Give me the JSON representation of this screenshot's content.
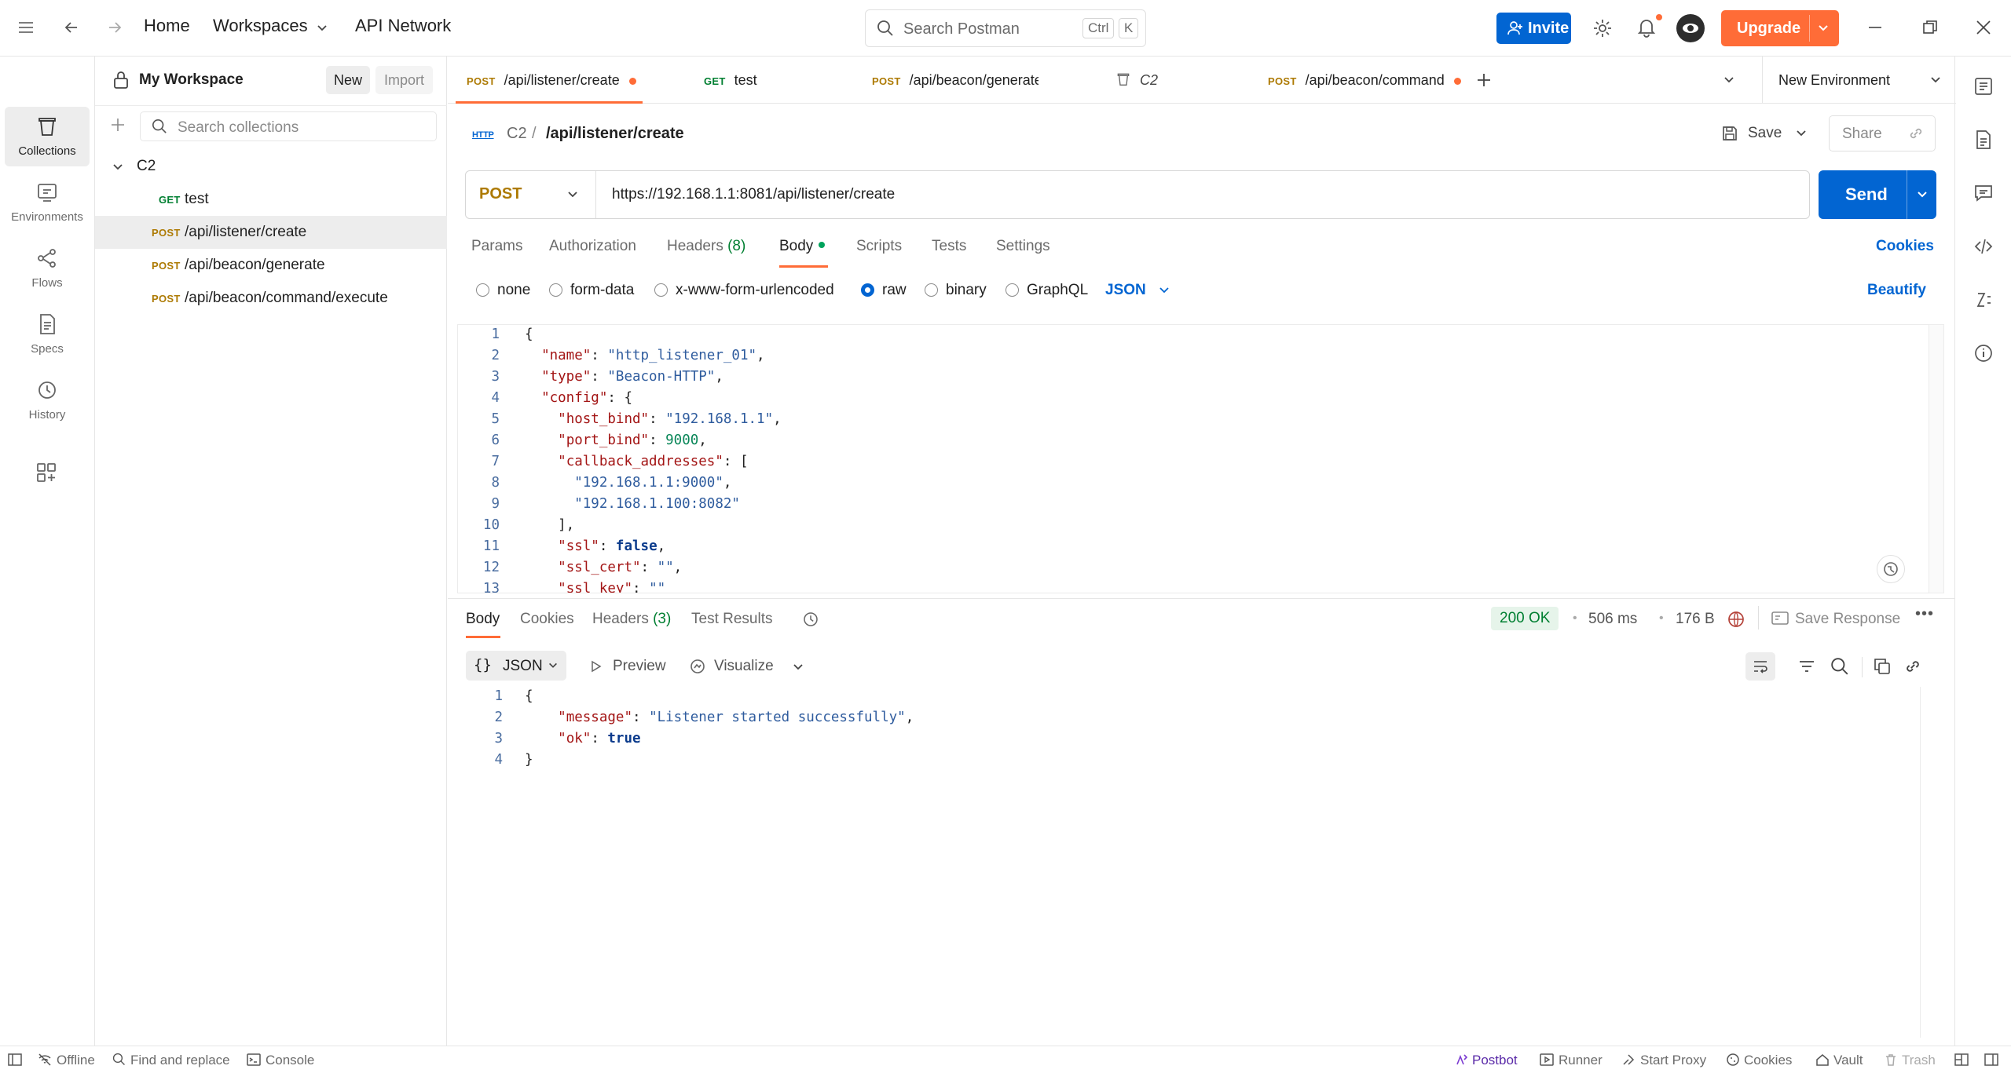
{
  "topbar": {
    "home": "Home",
    "workspaces": "Workspaces",
    "api_network": "API Network",
    "search_placeholder": "Search Postman",
    "kbd_ctrl": "Ctrl",
    "kbd_k": "K",
    "invite": "Invite",
    "upgrade": "Upgrade"
  },
  "rail": {
    "collections": "Collections",
    "environments": "Environments",
    "flows": "Flows",
    "specs": "Specs",
    "history": "History"
  },
  "sidebar": {
    "workspace": "My Workspace",
    "new": "New",
    "import": "Import",
    "search_placeholder": "Search collections",
    "collection": "C2",
    "items": [
      {
        "method": "GET",
        "name": "test"
      },
      {
        "method": "POST",
        "name": "/api/listener/create"
      },
      {
        "method": "POST",
        "name": "/api/beacon/generate"
      },
      {
        "method": "POST",
        "name": "/api/beacon/command/execute"
      }
    ]
  },
  "tabs": [
    {
      "method": "POST",
      "name": "/api/listener/create"
    },
    {
      "method": "GET",
      "name": "test"
    },
    {
      "method": "POST",
      "name": "/api/beacon/generate"
    },
    {
      "method": "",
      "name": "C2"
    },
    {
      "method": "POST",
      "name": "/api/beacon/command"
    }
  ],
  "environment": "New Environment",
  "request": {
    "crumb_icon": "HTTP",
    "crumb_collection": "C2",
    "crumb_sep": "/",
    "crumb_name": "/api/listener/create",
    "save": "Save",
    "share": "Share",
    "method": "POST",
    "url": "https://192.168.1.1:8081/api/listener/create",
    "send": "Send",
    "tabs": {
      "params": "Params",
      "authorization": "Authorization",
      "headers": "Headers",
      "headers_count": "(8)",
      "body": "Body",
      "scripts": "Scripts",
      "tests": "Tests",
      "settings": "Settings",
      "cookies": "Cookies"
    },
    "body_types": {
      "none": "none",
      "form_data": "form-data",
      "urlencoded": "x-www-form-urlencoded",
      "raw": "raw",
      "binary": "binary",
      "graphql": "GraphQL",
      "lang": "JSON",
      "beautify": "Beautify"
    },
    "body_lines": [
      [
        [
          "p",
          "{"
        ]
      ],
      [
        [
          "p",
          "  "
        ],
        [
          "k",
          "\"name\""
        ],
        [
          "p",
          ": "
        ],
        [
          "s",
          "\"http_listener_01\""
        ],
        [
          "p",
          ","
        ]
      ],
      [
        [
          "p",
          "  "
        ],
        [
          "k",
          "\"type\""
        ],
        [
          "p",
          ": "
        ],
        [
          "s",
          "\"Beacon-HTTP\""
        ],
        [
          "p",
          ","
        ]
      ],
      [
        [
          "p",
          "  "
        ],
        [
          "k",
          "\"config\""
        ],
        [
          "p",
          ": {"
        ]
      ],
      [
        [
          "p",
          "    "
        ],
        [
          "k",
          "\"host_bind\""
        ],
        [
          "p",
          ": "
        ],
        [
          "s",
          "\"192.168.1.1\""
        ],
        [
          "p",
          ","
        ]
      ],
      [
        [
          "p",
          "    "
        ],
        [
          "k",
          "\"port_bind\""
        ],
        [
          "p",
          ": "
        ],
        [
          "n",
          "9000"
        ],
        [
          "p",
          ","
        ]
      ],
      [
        [
          "p",
          "    "
        ],
        [
          "k",
          "\"callback_addresses\""
        ],
        [
          "p",
          ": ["
        ]
      ],
      [
        [
          "p",
          "      "
        ],
        [
          "s",
          "\"192.168.1.1:9000\""
        ],
        [
          "p",
          ","
        ]
      ],
      [
        [
          "p",
          "      "
        ],
        [
          "s",
          "\"192.168.1.100:8082\""
        ]
      ],
      [
        [
          "p",
          "    ],"
        ]
      ],
      [
        [
          "p",
          "    "
        ],
        [
          "k",
          "\"ssl\""
        ],
        [
          "p",
          ": "
        ],
        [
          "b",
          "false"
        ],
        [
          "p",
          ","
        ]
      ],
      [
        [
          "p",
          "    "
        ],
        [
          "k",
          "\"ssl_cert\""
        ],
        [
          "p",
          ": "
        ],
        [
          "s",
          "\"\""
        ],
        [
          "p",
          ","
        ]
      ],
      [
        [
          "p",
          "    "
        ],
        [
          "k",
          "\"ssl_key\""
        ],
        [
          "p",
          ": "
        ],
        [
          "s",
          "\"\""
        ]
      ]
    ]
  },
  "response": {
    "tabs": {
      "body": "Body",
      "cookies": "Cookies",
      "headers": "Headers",
      "headers_count": "(3)",
      "test_results": "Test Results"
    },
    "status": "200 OK",
    "time": "506 ms",
    "size": "176 B",
    "save_response": "Save Response",
    "format": "JSON",
    "preview": "Preview",
    "visualize": "Visualize",
    "body_lines": [
      [
        [
          "p",
          "{"
        ]
      ],
      [
        [
          "p",
          "    "
        ],
        [
          "k",
          "\"message\""
        ],
        [
          "p",
          ": "
        ],
        [
          "s",
          "\"Listener started successfully\""
        ],
        [
          "p",
          ","
        ]
      ],
      [
        [
          "p",
          "    "
        ],
        [
          "k",
          "\"ok\""
        ],
        [
          "p",
          ": "
        ],
        [
          "b",
          "true"
        ]
      ],
      [
        [
          "p",
          "}"
        ]
      ]
    ]
  },
  "statusbar": {
    "offline": "Offline",
    "find_replace": "Find and replace",
    "console": "Console",
    "postbot": "Postbot",
    "runner": "Runner",
    "start_proxy": "Start Proxy",
    "cookies": "Cookies",
    "vault": "Vault",
    "trash": "Trash"
  },
  "colors": {
    "accent": "#ff6c37",
    "primary": "#0265d2",
    "get": "#007f31",
    "post": "#ad7a03",
    "status_ok": "#007f31"
  }
}
